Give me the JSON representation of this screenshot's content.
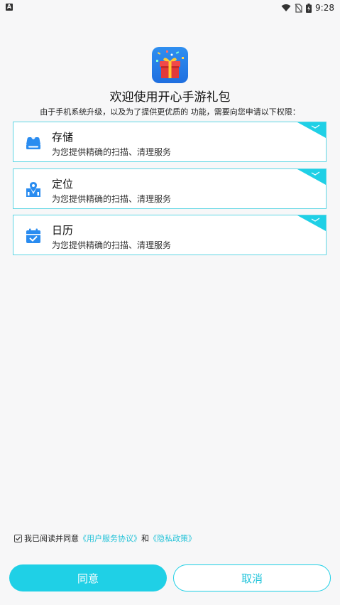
{
  "status_bar": {
    "left_icon": "A",
    "time": "9:28",
    "icons": [
      "wifi-icon",
      "no-sim-icon",
      "battery-charging-icon"
    ]
  },
  "header": {
    "app_icon": "gift-box-app-icon",
    "title": "欢迎使用开心手游礼包",
    "subtitle": "由于手机系统升级，以及为了提供更优质的 功能，需要向您申请以下权限："
  },
  "permissions": [
    {
      "name": "存储",
      "desc": "为您提供精确的扫描、清理服务",
      "icon": "storage-icon",
      "checked": true
    },
    {
      "name": "定位",
      "desc": "为您提供精确的扫描、清理服务",
      "icon": "location-icon",
      "checked": true
    },
    {
      "name": "日历",
      "desc": "为您提供精确的扫描、清理服务",
      "icon": "calendar-icon",
      "checked": true
    }
  ],
  "agreement": {
    "checked": true,
    "prefix": "我已阅读并同意",
    "user_agreement": "《用户服务协议》",
    "conjunction": "和",
    "privacy_policy": "《隐私政策》"
  },
  "buttons": {
    "agree": "同意",
    "cancel": "取消"
  },
  "colors": {
    "accent": "#1fd0e6",
    "icon_blue": "#2a8cf0",
    "card_border": "#5fd6e4",
    "background": "#f7f7f8"
  }
}
